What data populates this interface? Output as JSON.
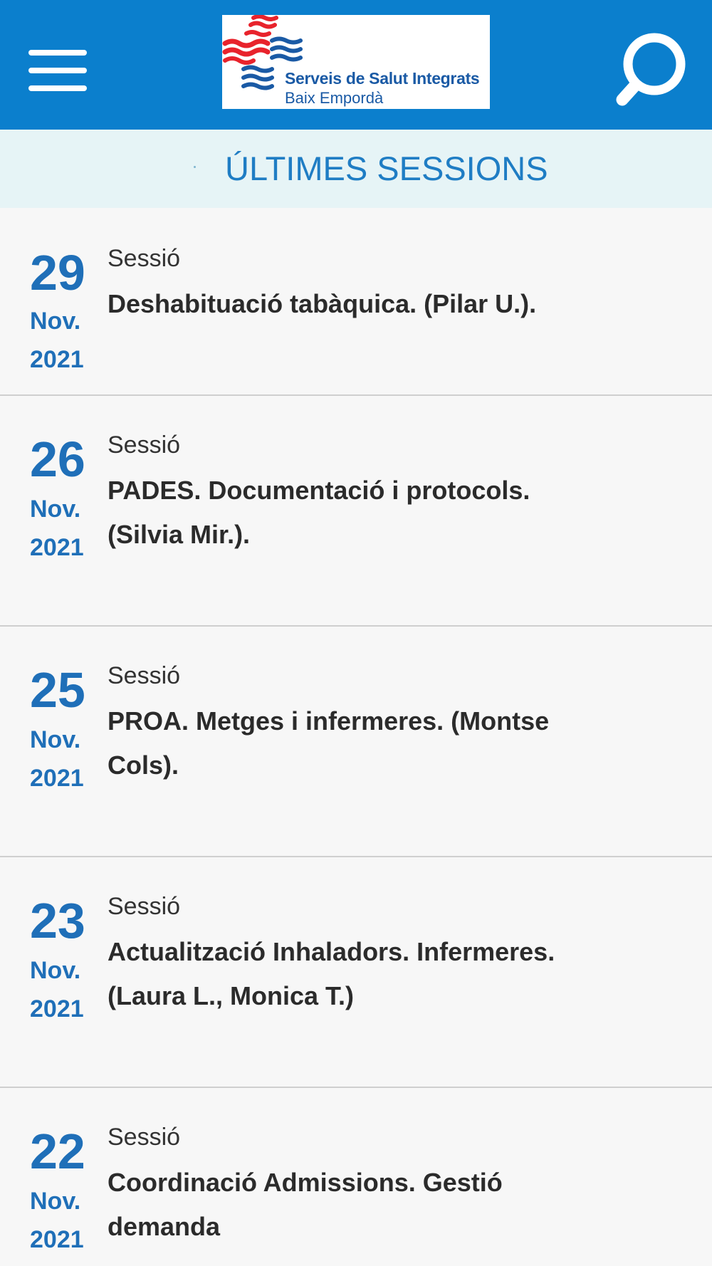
{
  "header": {
    "logo": {
      "name": "Serveis de Salut Integrats",
      "region": "Baix Empordà",
      "colors": {
        "red": "#e8232c",
        "blue": "#1a5aa5"
      }
    },
    "menu_icon": "hamburger-menu-icon",
    "search_icon": "search-icon",
    "background": "#0b7fcd"
  },
  "section": {
    "title": "ÚLTIMES SESSIONS"
  },
  "sessions": [
    {
      "day": "29",
      "month": "Nov.",
      "year": "2021",
      "kind": "Sessió",
      "title": "Deshabituació tabàquica. (Pilar U.)."
    },
    {
      "day": "26",
      "month": "Nov.",
      "year": "2021",
      "kind": "Sessió",
      "title": "PADES. Documentació i protocols. (Silvia Mir.)."
    },
    {
      "day": "25",
      "month": "Nov.",
      "year": "2021",
      "kind": "Sessió",
      "title": "PROA. Metges i infermeres. (Montse Cols)."
    },
    {
      "day": "23",
      "month": "Nov.",
      "year": "2021",
      "kind": "Sessió",
      "title": "Actualització Inhaladors. Infermeres. (Laura L., Monica T.)"
    },
    {
      "day": "22",
      "month": "Nov.",
      "year": "2021",
      "kind": "Sessió",
      "title": "Coordinació Admissions. Gestió demanda"
    }
  ]
}
